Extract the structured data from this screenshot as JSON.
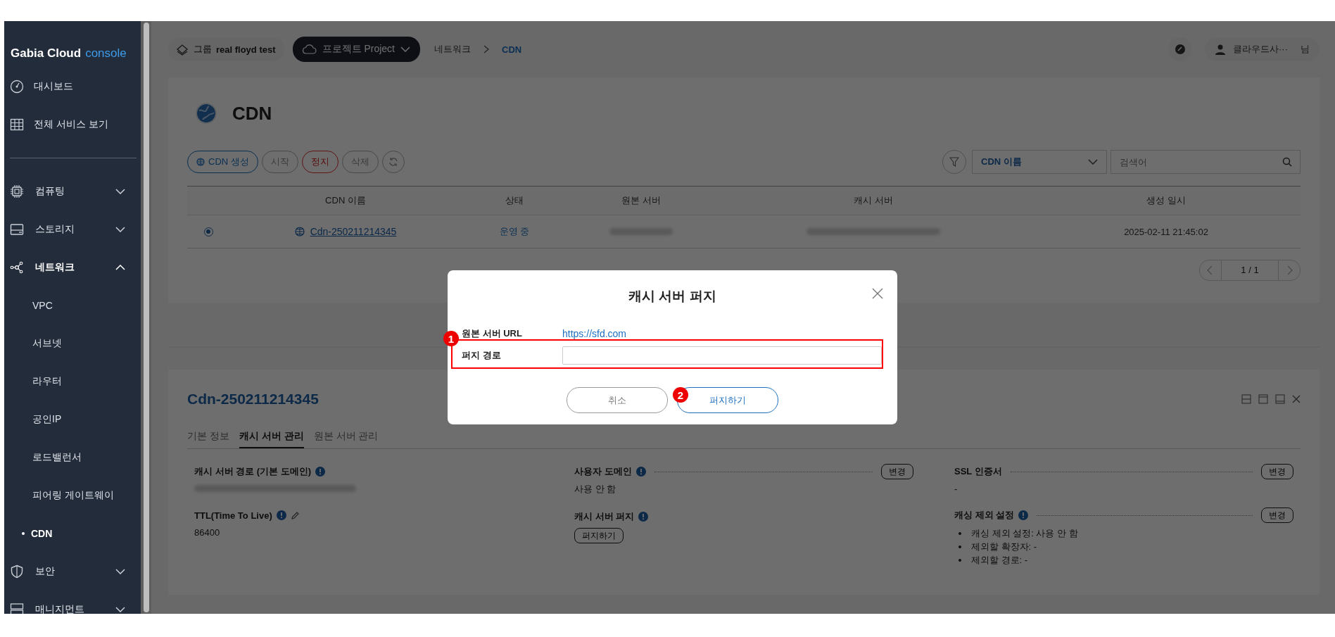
{
  "sidebar": {
    "logo_brand": "Gabia Cloud",
    "logo_product": "console",
    "links": [
      {
        "label": "대시보드"
      },
      {
        "label": "전체 서비스 보기"
      }
    ],
    "groups": [
      {
        "label": "컴퓨팅",
        "expanded": false
      },
      {
        "label": "스토리지",
        "expanded": false
      },
      {
        "label": "네트워크",
        "expanded": true,
        "children": [
          {
            "label": "VPC",
            "selected": false
          },
          {
            "label": "서브넷",
            "selected": false
          },
          {
            "label": "라우터",
            "selected": false
          },
          {
            "label": "공인IP",
            "selected": false
          },
          {
            "label": "로드밸런서",
            "selected": false
          },
          {
            "label": "피어링 게이트웨이",
            "selected": false
          },
          {
            "label": "CDN",
            "selected": true
          }
        ]
      },
      {
        "label": "보안",
        "expanded": false
      },
      {
        "label": "매니지먼트",
        "expanded": false
      }
    ]
  },
  "topbar": {
    "group_label": "그룹",
    "group_name": "real floyd test",
    "project": "프로젝트 Project",
    "breadcrumb": [
      "네트워크",
      "CDN"
    ],
    "user_name": "클라우드사···",
    "user_suffix": "님"
  },
  "page": {
    "title": "CDN",
    "actions": [
      {
        "label": "CDN 생성",
        "kind": "primary"
      },
      {
        "label": "시작",
        "kind": "default"
      },
      {
        "label": "정지",
        "kind": "danger"
      },
      {
        "label": "삭제",
        "kind": "default"
      },
      {
        "kind": "refresh"
      }
    ],
    "filter": {
      "select": "CDN 이름",
      "search_placeholder": "검색어"
    },
    "table": {
      "columns": [
        "CDN 이름",
        "상태",
        "원본 서버",
        "캐시 서버",
        "생성 일시"
      ],
      "rows": [
        {
          "selected": true,
          "name": "Cdn-250211214345",
          "status": "운영 중",
          "created": "2025-02-11 21:45:02"
        }
      ]
    },
    "pagination": "1 / 1"
  },
  "detail": {
    "title": "Cdn-250211214345",
    "tabs": [
      {
        "label": "기본 정보",
        "selected": false
      },
      {
        "label": "캐시 서버 관리",
        "selected": true
      },
      {
        "label": "원본 서버 관리",
        "selected": false
      }
    ],
    "columns": [
      [
        {
          "label": "캐시 서버 경로 (기본 도메인)",
          "info": true,
          "kind": "blurred"
        },
        {
          "label": "TTL(Time To Live)",
          "info": true,
          "editable": true,
          "kind": "text",
          "value": "86400"
        }
      ],
      [
        {
          "label": "사용자 도메인",
          "info": true,
          "button": "변경",
          "kind": "text",
          "value": "사용 안 함"
        },
        {
          "label": "캐시 서버 퍼지",
          "info": true,
          "kind": "action",
          "action": "퍼지하기"
        }
      ],
      [
        {
          "label": "SSL 인증서",
          "info": false,
          "button": "변경",
          "kind": "text",
          "value": "-"
        },
        {
          "label": "캐싱 제외 설정",
          "info": true,
          "button": "변경",
          "kind": "list",
          "items": [
            "캐싱 제외 설정: 사용 안 함",
            "제외할 확장자: -",
            "제외할 경로: -"
          ]
        }
      ]
    ]
  },
  "modal": {
    "title": "캐시 서버 퍼지",
    "origin_label": "원본 서버 URL",
    "origin_url": "https://sfd.com",
    "path_label": "퍼지 경로",
    "buttons": [
      {
        "label": "취소",
        "kind": "cancel"
      },
      {
        "label": "퍼지하기",
        "kind": "confirm"
      }
    ]
  },
  "annotations": [
    "1",
    "2"
  ]
}
